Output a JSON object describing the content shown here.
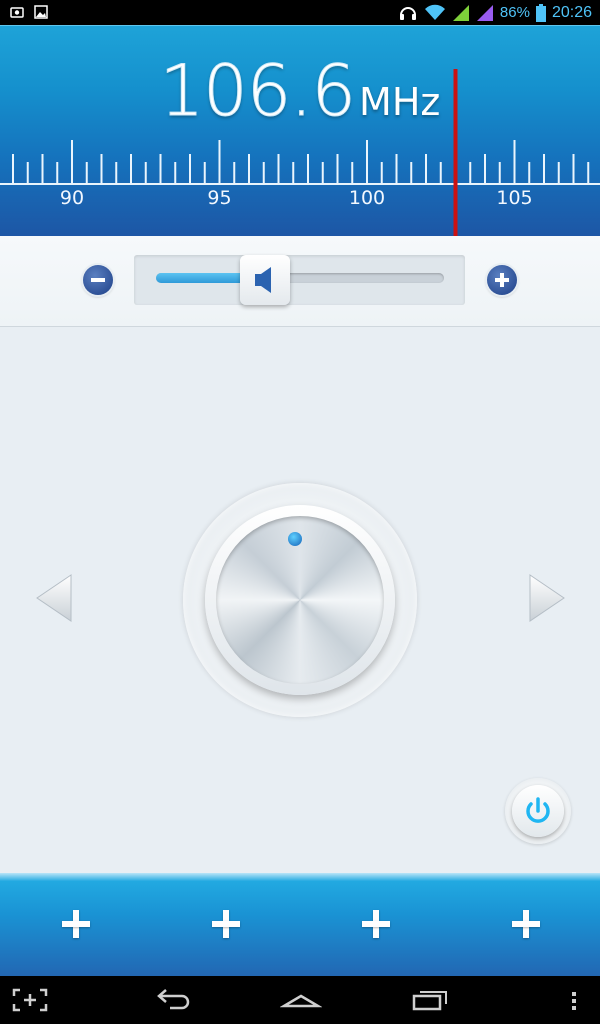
{
  "status_bar": {
    "battery_percent": "86%",
    "clock": "20:26",
    "icons": [
      "screenshot-icon",
      "gallery-icon",
      "headphones-icon",
      "wifi-icon",
      "signal-icon",
      "signal-icon-2",
      "battery-icon"
    ]
  },
  "tuner": {
    "frequency": "106.6",
    "unit": "MHz",
    "scale_labels": [
      "90",
      "95",
      "100",
      "105"
    ],
    "scale_range": [
      87.5,
      107.9
    ],
    "needle_value": 103.0,
    "needle_color": "#cc1111"
  },
  "volume": {
    "level": 0.3,
    "decrease_icon": "minus-icon",
    "increase_icon": "plus-icon",
    "thumb_icon": "speaker-icon"
  },
  "controls": {
    "prev_icon": "triangle-left-icon",
    "next_icon": "triangle-right-icon",
    "knob": "tuning-knob",
    "power_icon": "power-icon",
    "accent": "#1fb6f2"
  },
  "presets": {
    "count": 4,
    "icon": "plus-icon"
  },
  "nav_bar": {
    "icons": [
      "screenshot-icon",
      "back-icon",
      "home-icon",
      "recent-apps-icon",
      "menu-icon"
    ]
  }
}
